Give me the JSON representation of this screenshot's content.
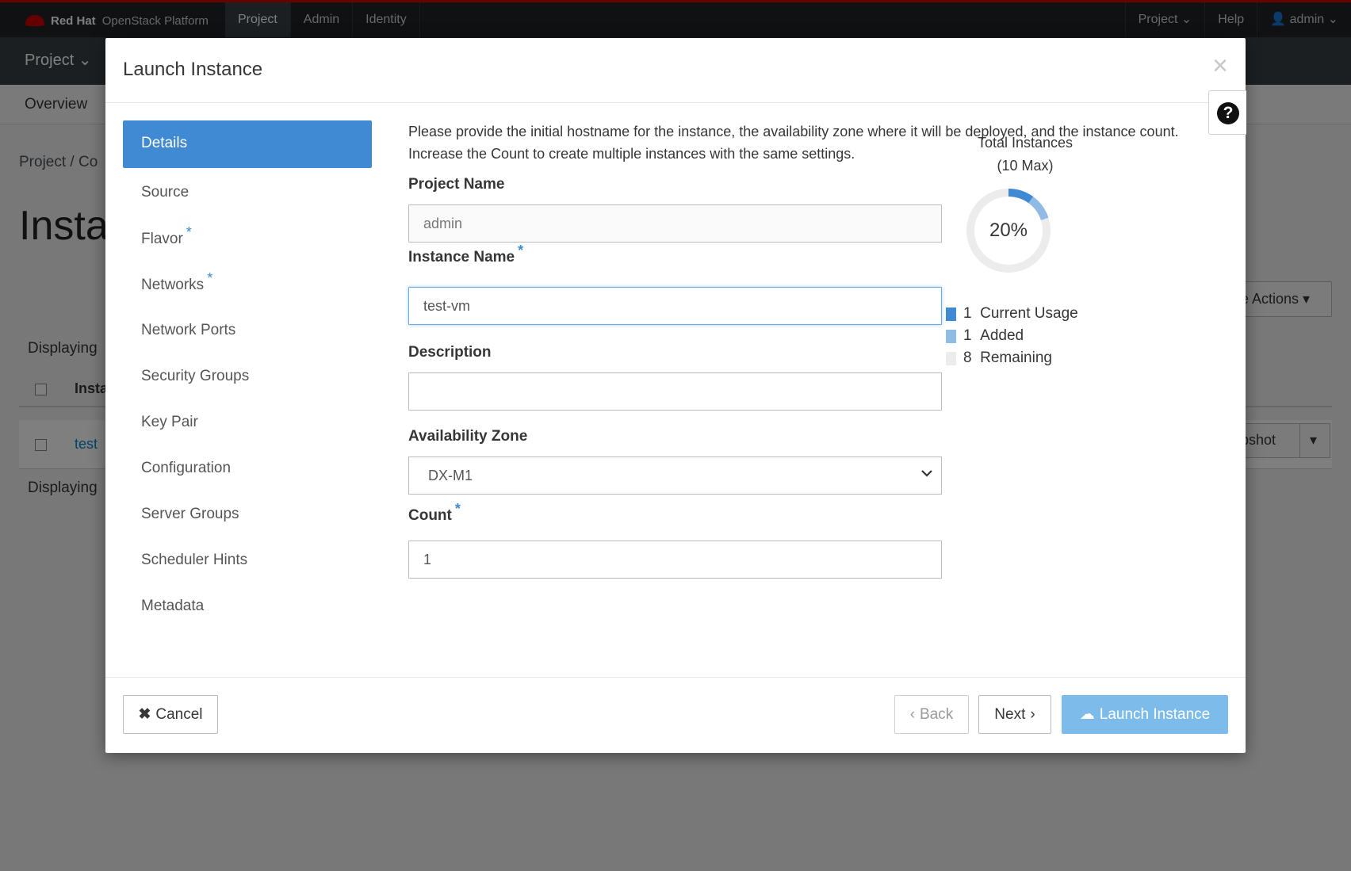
{
  "topbar": {
    "brand_bold": "Red Hat",
    "brand_light": "OpenStack Platform",
    "nav": [
      "Project",
      "Admin",
      "Identity"
    ],
    "right": [
      "Project",
      "Help",
      "admin"
    ]
  },
  "subbar": {
    "project": "Project"
  },
  "tabs": {
    "overview": "Overview"
  },
  "background": {
    "breadcrumb": "Project /  Co",
    "page_title": "Insta",
    "displaying_1": "Displaying",
    "displaying_2": "Displaying",
    "col_header": "Insta",
    "row_link": "test",
    "more_actions": "e Actions",
    "snapshot": "pshot"
  },
  "modal": {
    "title": "Launch Instance",
    "close_glyph": "×",
    "help_glyph": "?",
    "steps": [
      {
        "label": "Details",
        "required": false
      },
      {
        "label": "Source",
        "required": false
      },
      {
        "label": "Flavor",
        "required": true
      },
      {
        "label": "Networks",
        "required": true
      },
      {
        "label": "Network Ports",
        "required": false
      },
      {
        "label": "Security Groups",
        "required": false
      },
      {
        "label": "Key Pair",
        "required": false
      },
      {
        "label": "Configuration",
        "required": false
      },
      {
        "label": "Server Groups",
        "required": false
      },
      {
        "label": "Scheduler Hints",
        "required": false
      },
      {
        "label": "Metadata",
        "required": false
      }
    ],
    "required_mark": "*",
    "intro": "Please provide the initial hostname for the instance, the availability zone where it will be deployed, and the instance count. Increase the Count to create multiple instances with the same settings.",
    "fields": {
      "project_name_label": "Project Name",
      "project_name_value": "admin",
      "instance_name_label": "Instance Name",
      "instance_name_value": "test-vm",
      "description_label": "Description",
      "description_value": "",
      "az_label": "Availability Zone",
      "az_value": "DX-M1",
      "count_label": "Count",
      "count_value": "1"
    },
    "quota": {
      "title_line1": "Total Instances",
      "title_line2": "(10 Max)",
      "percent_text": "20%",
      "max": 10,
      "current": 1,
      "added": 1,
      "remaining": 8,
      "legend": [
        {
          "count": "1",
          "label": "Current Usage",
          "color": "#3f8ad2"
        },
        {
          "count": "1",
          "label": "Added",
          "color": "#8fbbe5"
        },
        {
          "count": "8",
          "label": "Remaining",
          "color": "#ececec"
        }
      ]
    },
    "footer": {
      "cancel": "Cancel",
      "back": "Back",
      "next": "Next",
      "launch": "Launch Instance"
    }
  }
}
